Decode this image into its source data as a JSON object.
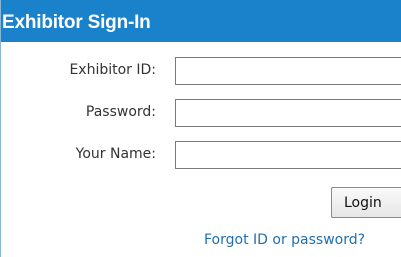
{
  "header": {
    "title": "Exhibitor Sign-In"
  },
  "form": {
    "exhibitor_id": {
      "label": "Exhibitor ID:",
      "value": "",
      "placeholder": ""
    },
    "password": {
      "label": "Password:",
      "value": "",
      "placeholder": ""
    },
    "your_name": {
      "label": "Your Name:",
      "value": "",
      "placeholder": ""
    },
    "login_label": "Login",
    "forgot_link": "Forgot ID or password?"
  },
  "colors": {
    "header_bg": "#1a82ca",
    "header_text": "#ffffff",
    "link": "#1f6fb0"
  }
}
